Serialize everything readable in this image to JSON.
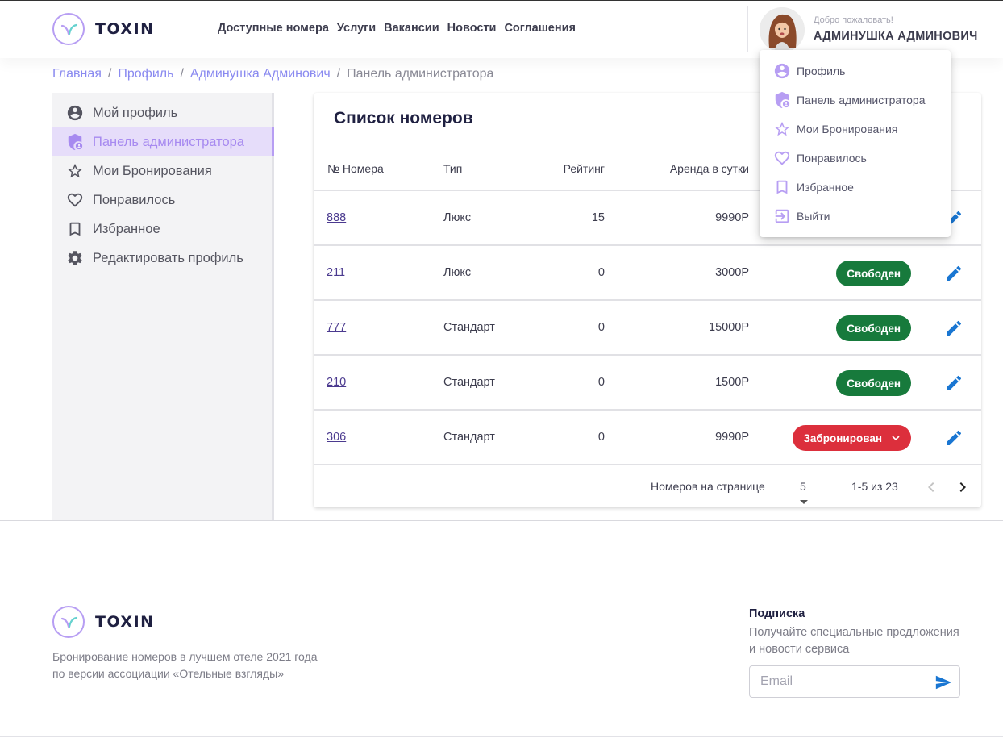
{
  "header": {
    "logo_text": "TOXIN",
    "nav": [
      "Доступные номера",
      "Услуги",
      "Вакансии",
      "Новости",
      "Соглашения"
    ],
    "welcome": "Добро пожаловать!",
    "username": "АДМИНУШКА АДМИНОВИЧ"
  },
  "breadcrumb": {
    "items": [
      "Главная",
      "Профиль",
      "Админушка Админович"
    ],
    "current": "Панель администратора"
  },
  "sidebar": {
    "items": [
      {
        "label": "Мой профиль",
        "icon": "account-circle-icon"
      },
      {
        "label": "Панель администратора",
        "icon": "admin-shield-icon",
        "active": true
      },
      {
        "label": "Мои Бронирования",
        "icon": "star-outline-icon"
      },
      {
        "label": "Понравилось",
        "icon": "heart-outline-icon"
      },
      {
        "label": "Избранное",
        "icon": "bookmark-outline-icon"
      },
      {
        "label": "Редактировать профиль",
        "icon": "gear-icon"
      }
    ]
  },
  "rooms_table": {
    "title": "Список номеров",
    "columns": [
      "№ Номера",
      "Тип",
      "Рейтинг",
      "Аренда в сутки"
    ],
    "rows": [
      {
        "number": "888",
        "type": "Люкс",
        "rating": "15",
        "price": "9990Р",
        "status": ""
      },
      {
        "number": "211",
        "type": "Люкс",
        "rating": "0",
        "price": "3000Р",
        "status": "Свободен"
      },
      {
        "number": "777",
        "type": "Стандарт",
        "rating": "0",
        "price": "15000Р",
        "status": "Свободен"
      },
      {
        "number": "210",
        "type": "Стандарт",
        "rating": "0",
        "price": "1500Р",
        "status": "Свободен"
      },
      {
        "number": "306",
        "type": "Стандарт",
        "rating": "0",
        "price": "9990Р",
        "status": "Забронирован"
      }
    ],
    "pagination": {
      "per_page_label": "Номеров на странице",
      "per_page_value": "5",
      "range": "1-5 из 23"
    }
  },
  "user_menu": {
    "items": [
      {
        "label": "Профиль",
        "icon": "account-circle-icon"
      },
      {
        "label": "Панель администратора",
        "icon": "admin-shield-icon"
      },
      {
        "label": "Мои Бронирования",
        "icon": "star-outline-icon"
      },
      {
        "label": "Понравилось",
        "icon": "heart-outline-icon"
      },
      {
        "label": "Избранное",
        "icon": "bookmark-outline-icon"
      },
      {
        "label": "Выйти",
        "icon": "logout-icon"
      }
    ]
  },
  "footer": {
    "logo_text": "TOXIN",
    "description_line1": "Бронирование номеров в лучшем отеле 2021 года",
    "description_line2": "по версии ассоциации «Отельные взгляды»",
    "subscribe_title": "Подписка",
    "subscribe_desc_line1": "Получайте специальные предложения",
    "subscribe_desc_line2": "и новости сервиса",
    "email_placeholder": "Email"
  },
  "colors": {
    "accent": "#b79ef3",
    "free": "#177a3c",
    "booked": "#dc2f3c",
    "edit": "#1976d2"
  }
}
